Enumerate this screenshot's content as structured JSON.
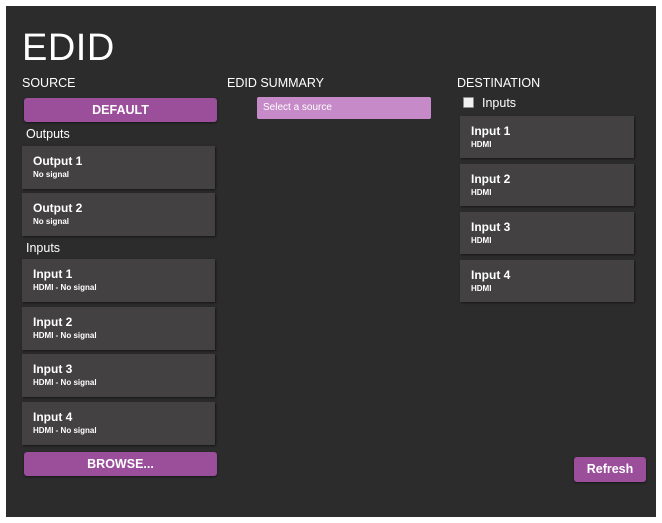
{
  "page": {
    "title": "EDID"
  },
  "source": {
    "header": "SOURCE",
    "default_label": "DEFAULT",
    "outputs_label": "Outputs",
    "outputs": [
      {
        "title": "Output 1",
        "status": "No signal"
      },
      {
        "title": "Output 2",
        "status": "No signal"
      }
    ],
    "inputs_label": "Inputs",
    "inputs": [
      {
        "title": "Input 1",
        "status": "HDMI - No signal"
      },
      {
        "title": "Input 2",
        "status": "HDMI - No signal"
      },
      {
        "title": "Input 3",
        "status": "HDMI - No signal"
      },
      {
        "title": "Input 4",
        "status": "HDMI - No signal"
      }
    ],
    "browse_label": "BROWSE..."
  },
  "summary": {
    "header": "EDID SUMMARY",
    "select_placeholder": "Select a source"
  },
  "destination": {
    "header": "DESTINATION",
    "inputs_checkbox_label": "Inputs",
    "inputs_checked": false,
    "items": [
      {
        "title": "Input 1",
        "type": "HDMI"
      },
      {
        "title": "Input 2",
        "type": "HDMI"
      },
      {
        "title": "Input 3",
        "type": "HDMI"
      },
      {
        "title": "Input 4",
        "type": "HDMI"
      }
    ],
    "refresh_label": "Refresh"
  },
  "colors": {
    "background": "#2d2c2c",
    "card": "#434142",
    "accent": "#9b4f9b",
    "select_fill": "#c68ac8"
  }
}
